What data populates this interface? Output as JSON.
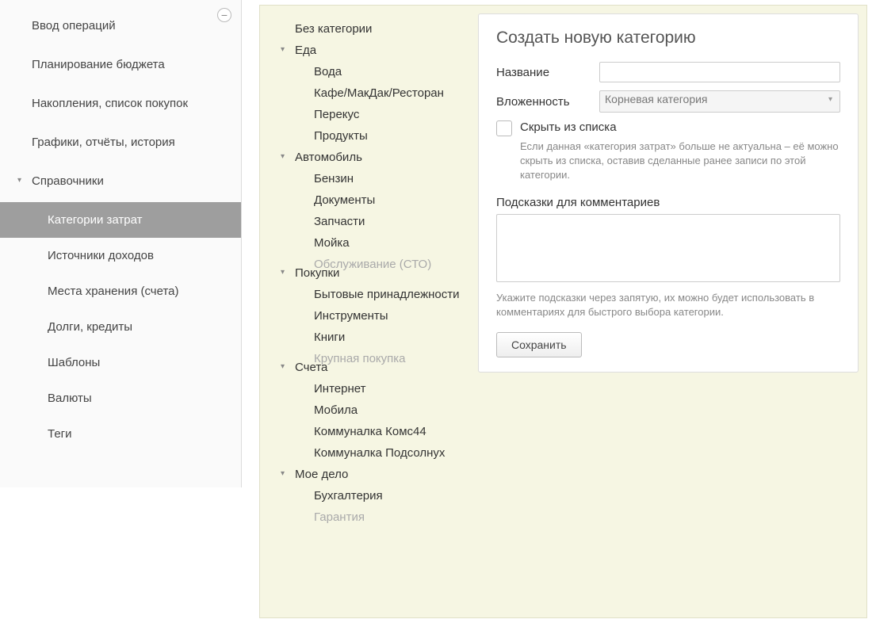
{
  "sidebar": {
    "items": [
      {
        "label": "Ввод операций",
        "expandable": false
      },
      {
        "label": "Планирование бюджета",
        "expandable": false
      },
      {
        "label": "Накопления, список покупок",
        "expandable": false
      },
      {
        "label": "Графики, отчёты, история",
        "expandable": false
      },
      {
        "label": "Справочники",
        "expandable": true
      }
    ],
    "subitems": [
      {
        "label": "Категории затрат",
        "active": true
      },
      {
        "label": "Источники доходов",
        "active": false
      },
      {
        "label": "Места хранения (счета)",
        "active": false
      },
      {
        "label": "Долги, кредиты",
        "active": false
      },
      {
        "label": "Шаблоны",
        "active": false
      },
      {
        "label": "Валюты",
        "active": false
      },
      {
        "label": "Теги",
        "active": false
      }
    ]
  },
  "tree": [
    {
      "label": "Без категории",
      "level": 0,
      "expandable": false
    },
    {
      "label": "Еда",
      "level": 0,
      "expandable": true
    },
    {
      "label": "Вода",
      "level": 1,
      "expandable": false
    },
    {
      "label": "Кафе/МакДак/Ресторан",
      "level": 1,
      "expandable": false
    },
    {
      "label": "Перекус",
      "level": 1,
      "expandable": false
    },
    {
      "label": "Продукты",
      "level": 1,
      "expandable": false
    },
    {
      "label": "Автомобиль",
      "level": 0,
      "expandable": true
    },
    {
      "label": "Бензин",
      "level": 1,
      "expandable": false
    },
    {
      "label": "Документы",
      "level": 1,
      "expandable": false
    },
    {
      "label": "Запчасти",
      "level": 1,
      "expandable": false
    },
    {
      "label": "Мойка",
      "level": 1,
      "expandable": false
    },
    {
      "label": "Обслуживание (СТО)",
      "level": 1,
      "expandable": false,
      "faded": true
    },
    {
      "label": "Покупки",
      "level": 0,
      "expandable": true
    },
    {
      "label": "Бытовые принадлежности",
      "level": 1,
      "expandable": false
    },
    {
      "label": "Инструменты",
      "level": 1,
      "expandable": false
    },
    {
      "label": "Книги",
      "level": 1,
      "expandable": false
    },
    {
      "label": "Крупная покупка",
      "level": 1,
      "expandable": false,
      "faded": true
    },
    {
      "label": "Счета",
      "level": 0,
      "expandable": true
    },
    {
      "label": "Интернет",
      "level": 1,
      "expandable": false
    },
    {
      "label": "Мобила",
      "level": 1,
      "expandable": false
    },
    {
      "label": "Коммуналка Комс44",
      "level": 1,
      "expandable": false
    },
    {
      "label": "Коммуналка Подсолнух",
      "level": 1,
      "expandable": false
    },
    {
      "label": "Мое дело",
      "level": 0,
      "expandable": true
    },
    {
      "label": "Бухгалтерия",
      "level": 1,
      "expandable": false
    },
    {
      "label": "Гарантия",
      "level": 1,
      "expandable": false,
      "faded": true
    }
  ],
  "form": {
    "title": "Создать новую категорию",
    "name_label": "Название",
    "name_value": "",
    "nesting_label": "Вложенность",
    "nesting_value": "Корневая категория",
    "hide_label": "Скрыть из списка",
    "hide_hint": "Если данная «категория затрат» больше не актуальна – её можно скрыть из списка, оставив сделанные ранее записи по этой категории.",
    "hints_label": "Подсказки для комментариев",
    "hints_value": "",
    "hints_hint": "Укажите подсказки через запятую, их можно будет использовать в комментариях для быстрого выбора категории.",
    "save_label": "Сохранить"
  }
}
